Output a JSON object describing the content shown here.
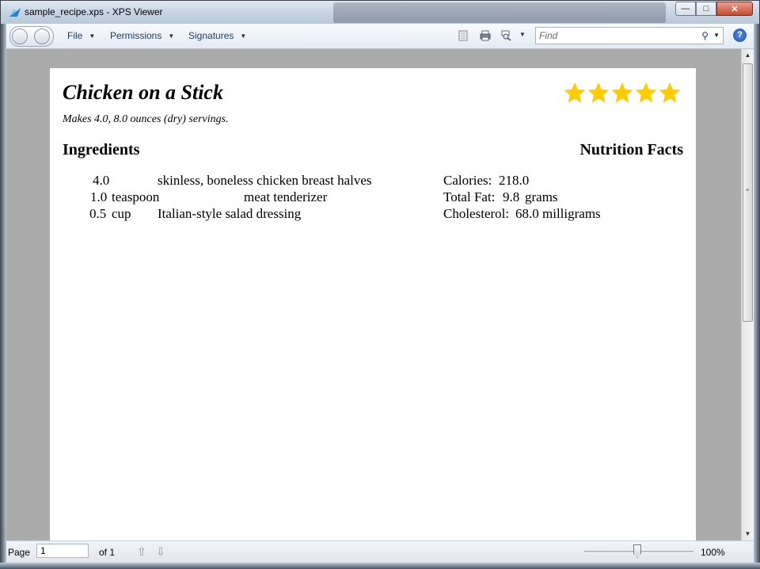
{
  "window": {
    "title": "sample_recipe.xps - XPS Viewer"
  },
  "toolbar": {
    "menus": [
      "File",
      "Permissions",
      "Signatures"
    ],
    "find_placeholder": "Find",
    "help_label": "?"
  },
  "recipe": {
    "title": "Chicken on a Stick",
    "subtitle": "Makes 4.0, 8.0 ounces (dry) servings.",
    "rating": 5,
    "rating_max": 5,
    "ingredients_heading": "Ingredients",
    "nutrition_heading": "Nutrition Facts",
    "ingredients": [
      {
        "qty": "4.0",
        "unit": "",
        "name": "skinless, boneless chicken breast halves"
      },
      {
        "qty": "1.0",
        "unit": "teaspoon",
        "name": "meat tenderizer"
      },
      {
        "qty": "0.5",
        "unit": "cup",
        "name": "Italian-style salad dressing"
      }
    ],
    "nutrition": [
      {
        "label": "Calories:",
        "value": "218.0",
        "unit": ""
      },
      {
        "label": "Total Fat:",
        "value": "9.8",
        "unit": "grams"
      },
      {
        "label": "Cholesterol:",
        "value": "68.0",
        "unit": "milligrams"
      }
    ]
  },
  "status": {
    "page_label": "Page",
    "page_value": "1",
    "of_label": "of 1",
    "zoom_label": "100%"
  },
  "colors": {
    "star": "#ffcc00",
    "page_bg": "#ababab"
  },
  "icons": [
    "app-icon",
    "back-icon",
    "forward-icon",
    "document-icon",
    "print-icon",
    "zoom-icon",
    "search-icon",
    "help-icon",
    "arrow-up-icon",
    "arrow-down-icon"
  ]
}
